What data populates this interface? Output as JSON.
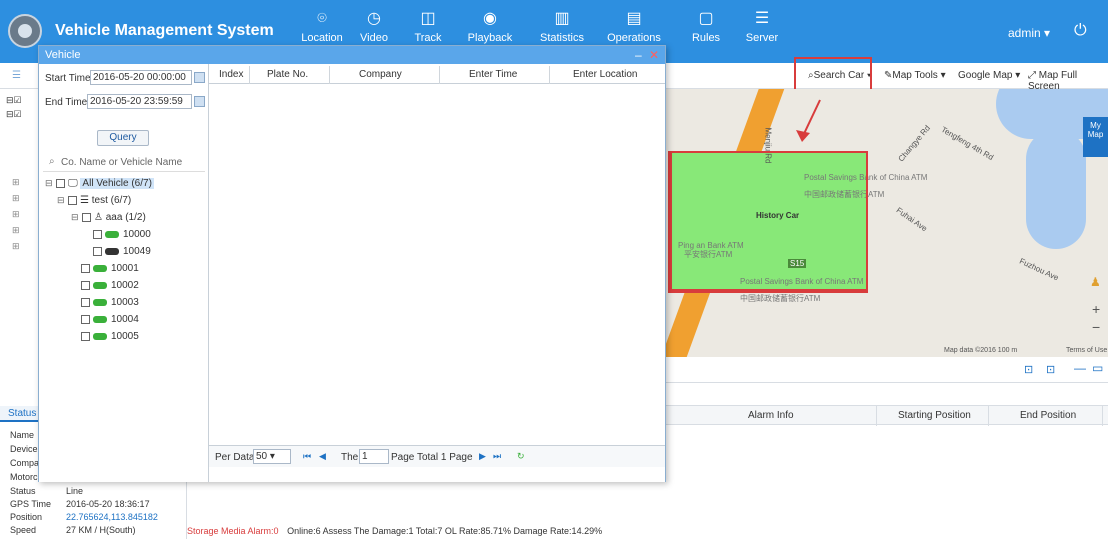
{
  "app": {
    "title": "Vehicle Management System",
    "user": "admin"
  },
  "nav": [
    {
      "label": "Location",
      "icon": "location-pin-icon"
    },
    {
      "label": "Video",
      "icon": "play-circle-icon"
    },
    {
      "label": "Track",
      "icon": "track-icon"
    },
    {
      "label": "Playback",
      "icon": "playback-icon"
    },
    {
      "label": "Statistics",
      "icon": "chart-icon"
    },
    {
      "label": "Operations",
      "icon": "operations-icon"
    },
    {
      "label": "Rules",
      "icon": "rules-icon"
    },
    {
      "label": "Server",
      "icon": "server-icon"
    }
  ],
  "toolbar": {
    "search_car": "Search Car",
    "map_tools": "Map Tools",
    "google_map": "Google Map",
    "full_screen": "Map Full Screen"
  },
  "map": {
    "labels": [
      "History Car",
      "Postal Savings Bank of China ATM",
      "中国邮政储蓄银行ATM",
      "Ping an Bank ATM",
      "平安银行ATM",
      "Postal Savings Bank of China ATM",
      "中国邮政储蓄银行ATM",
      "Tengfeng 4th Rd",
      "Changye Rd",
      "Fuhai Ave",
      "Fuzhou Ave",
      "Menjiu Rd",
      "S15"
    ],
    "copyright": "Map data ©2016   100 m",
    "terms": "Terms of Use",
    "my_map": "My Map"
  },
  "dialog": {
    "title": "Vehicle",
    "start_label": "Start Time:",
    "start_value": "2016-05-20 00:00:00",
    "end_label": "End Time:",
    "end_value": "2016-05-20 23:59:59",
    "query": "Query",
    "search_placeholder": "Co. Name or Vehicle Name",
    "tree": [
      {
        "label": "All Vehicle  (6/7)",
        "type": "root"
      },
      {
        "label": "test  (6/7)",
        "type": "group"
      },
      {
        "label": "aaa  (1/2)",
        "type": "sub"
      },
      {
        "label": "10000",
        "type": "car-online"
      },
      {
        "label": "10049",
        "type": "car-offline"
      },
      {
        "label": "10001",
        "type": "car-online"
      },
      {
        "label": "10002",
        "type": "car-online"
      },
      {
        "label": "10003",
        "type": "car-online"
      },
      {
        "label": "10004",
        "type": "car-online"
      },
      {
        "label": "10005",
        "type": "car-online"
      }
    ],
    "columns": [
      "Index",
      "Plate No.",
      "Company",
      "Enter Time",
      "Enter Location"
    ],
    "pager": {
      "per_data": "Per Data",
      "per_value": "50",
      "the": "The",
      "page_value": "1",
      "page_total": "Page  Total 1 Page"
    }
  },
  "status": {
    "tab": "Status",
    "rows": [
      {
        "label": "Name",
        "value": ""
      },
      {
        "label": "Device",
        "value": ""
      },
      {
        "label": "Compa",
        "value": ""
      },
      {
        "label": "Motorc",
        "value": ""
      },
      {
        "label": "Status",
        "value": "Line"
      },
      {
        "label": "GPS Time",
        "value": "2016-05-20 18:36:17"
      },
      {
        "label": "Position",
        "value": "22.765624,113.845182"
      },
      {
        "label": "Speed",
        "value": "27 KM / H(South)"
      }
    ]
  },
  "alarm": {
    "columns": [
      "Alarm Info",
      "Starting Position",
      "End Position"
    ]
  },
  "footer": {
    "storage": "Storage Media Alarm:0",
    "stats": "Online:6   Assess The Damage:1   Total:7   OL Rate:85.71%   Damage Rate:14.29%"
  },
  "colors": {
    "header": "#2d8fe0",
    "annotation": "#d83c3c",
    "geofence": "#88e878"
  }
}
